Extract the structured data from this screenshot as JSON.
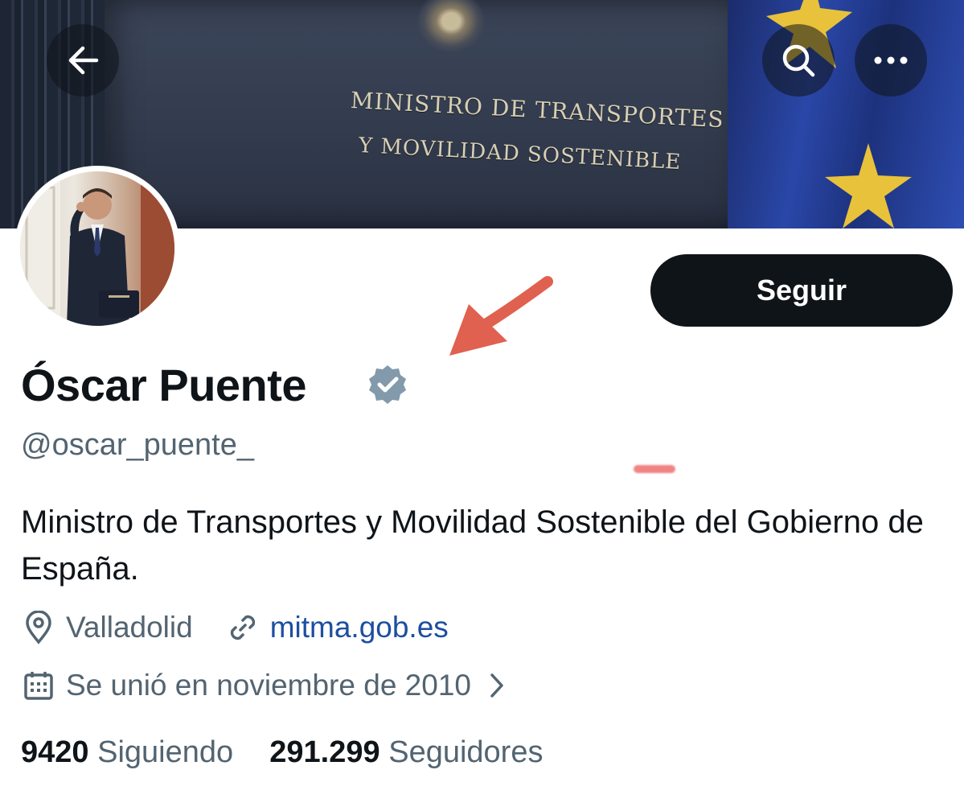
{
  "banner": {
    "line1": "MINISTRO DE TRANSPORTES",
    "line2": "Y MOVILIDAD SOSTENIBLE"
  },
  "header": {
    "back_icon": "arrow-left-icon",
    "search_icon": "search-icon",
    "more_icon": "more-horizontal-icon"
  },
  "profile": {
    "name": "Óscar Puente",
    "handle": "@oscar_puente_",
    "follow_label": "Seguir",
    "bio": "Ministro de Transportes y Movilidad Sostenible del Gobierno de España.",
    "location": "Valladolid",
    "website": "mitma.gob.es",
    "joined": "Se unió en noviembre de 2010",
    "following_count": "9420",
    "following_label": "Siguiendo",
    "followers_count": "291.299",
    "followers_label": "Seguidores"
  },
  "colors": {
    "text_primary": "#0f1419",
    "text_secondary": "#536471",
    "link": "#1d4ea0",
    "verified_badge": "#829aab",
    "annotation": "#e0614f"
  }
}
